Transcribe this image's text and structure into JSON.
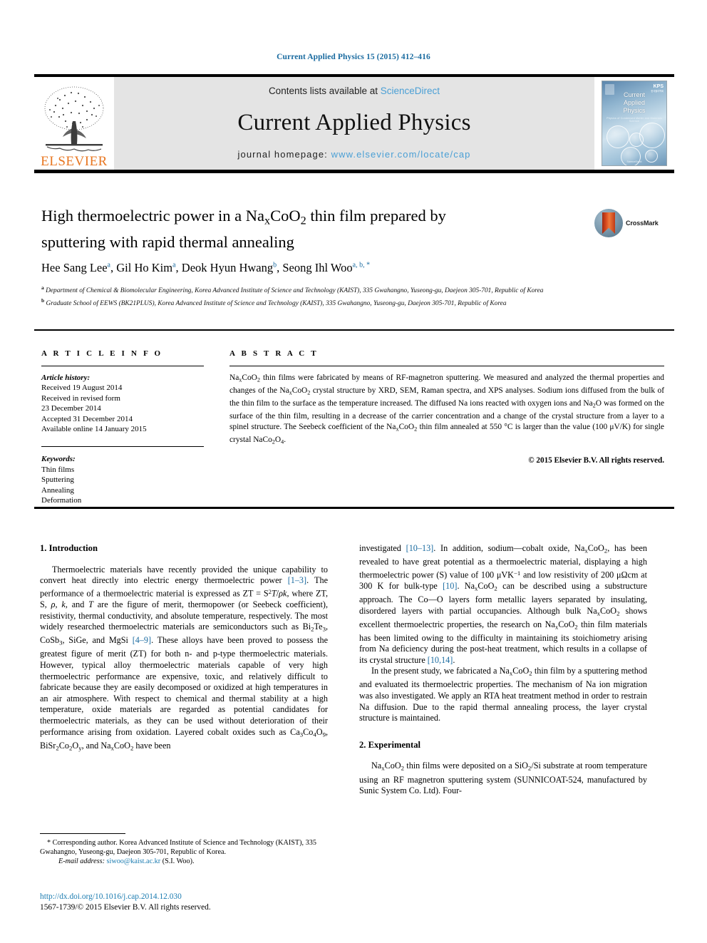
{
  "running_head": "Current Applied Physics 15 (2015) 412–416",
  "masthead": {
    "contents_prefix": "Contents lists available at ",
    "contents_link": "ScienceDirect",
    "journal_title": "Current Applied Physics",
    "homepage_prefix": "journal homepage: ",
    "homepage_url": "www.elsevier.com/locate/cap",
    "publisher_wordmark": "ELSEVIER",
    "cover": {
      "line1": "Current",
      "line2": "Applied",
      "line3": "Physics",
      "subtitle": "Physics of Condensed Matter and Materials Science",
      "badge": "KPS",
      "badge_sub": "한국물리학회",
      "footer": "ScienceDirect"
    }
  },
  "article": {
    "title_line1": "High thermoelectric power in a Na",
    "title_sub1": "x",
    "title_line1b": "CoO",
    "title_sub2": "2",
    "title_line1c": " thin film prepared by",
    "title_line2": "sputtering with rapid thermal annealing",
    "crossmark_label": "CrossMark",
    "authors": [
      {
        "name": "Hee Sang Lee",
        "marks": "a"
      },
      {
        "name": "Gil Ho Kim",
        "marks": "a"
      },
      {
        "name": "Deok Hyun Hwang",
        "marks": "b"
      },
      {
        "name": "Seong Ihl Woo",
        "marks": "a, b, *"
      }
    ],
    "affiliations": [
      {
        "mark": "a",
        "text": "Department of Chemical & Biomolecular Engineering, Korea Advanced Institute of Science and Technology (KAIST), 335 Gwahangno, Yuseong-gu, Daejeon 305-701, Republic of Korea"
      },
      {
        "mark": "b",
        "text": "Graduate School of EEWS (BK21PLUS), Korea Advanced Institute of Science and Technology (KAIST), 335 Gwahangno, Yuseong-gu, Daejeon 305-701, Republic of Korea"
      }
    ]
  },
  "info": {
    "heading": "A R T I C L E   I N F O",
    "history_label": "Article history:",
    "history": [
      "Received 19 August 2014",
      "Received in revised form",
      "23 December 2014",
      "Accepted 31 December 2014",
      "Available online 14 January 2015"
    ],
    "keywords_label": "Keywords:",
    "keywords": [
      "Thin films",
      "Sputtering",
      "Annealing",
      "Deformation"
    ]
  },
  "abstract": {
    "heading": "A B S T R A C T",
    "body": "thin films were fabricated by means of RF-magnetron sputtering. We measured and analyzed the thermal properties and changes of the Na CoO crystal structure by XRD, SEM, Raman spectra, and XPS analyses. Sodium ions diffused from the bulk of the thin film to the surface as the temperature increased. The diffused Na ions reacted with oxygen ions and Na O was formed on the surface of the thin film, resulting in a decrease of the carrier concentration and a change of the crystal structure from a layer to a spinel structure. The Seebeck coefficient of the Na CoO thin film annealed at 550 °C is larger than the value (100 μV/K) for single crystal NaCo O .",
    "copyright": "© 2015 Elsevier B.V. All rights reserved."
  },
  "sections": {
    "intro_heading": "1.  Introduction",
    "experimental_heading": "2.  Experimental",
    "intro_p1_parts": {
      "t1": "Thermoelectric materials have recently provided the unique capability to convert heat directly into electric energy thermoelectric power ",
      "ref1": "[1–3]",
      "t2": ". The performance of a thermoelectric material is expressed as ZT = S",
      "t3": "T/ρk, where ZT, S, ρ, k, and T are the figure of merit, thermopower (or Seebeck coefficient), resistivity, thermal conductivity, and absolute temperature, respectively. The most widely researched thermoelectric materials are semiconductors such as Bi",
      "t4": "Te",
      "t5": ", CoSb",
      "t6": ", SiGe, and MgSi ",
      "ref2": "[4–9]",
      "t7": ". These alloys have been proved to possess the greatest figure of merit (ZT) for both n- and p-type thermoelectric materials. However, typical alloy thermoelectric materials capable of very high thermoelectric performance are expensive, toxic, and relatively difficult to fabricate because they are easily decomposed or oxidized at high temperatures in an air atmosphere. With respect to chemical and thermal stability at a high temperature, oxide materials are regarded as potential candidates for thermoelectric materials, as they can be used without deterioration of their performance arising from oxidation. Layered cobalt oxides such as Ca",
      "t8": "Co",
      "t9": "O",
      "t10": ", BiSr",
      "t11": "Co",
      "t12": "O",
      "t13": ", and Na",
      "t14": "CoO",
      "t15": " have been"
    },
    "right_p1_parts": {
      "t1": "investigated ",
      "ref1": "[10–13]",
      "t2": ". In addition, sodium—cobalt oxide, Na",
      "t3": "CoO",
      "t4": ", has been revealed to have great potential as a thermoelectric material, displaying a high thermoelectric power (S) value of 100 μVK",
      "t5": "−1",
      "t6": " and low resistivity of 200 μΩcm at 300 K for bulk-type ",
      "ref2": "[10]",
      "t7": ". Na",
      "t8": "CoO",
      "t9": " can be described using a substructure approach. The Co—O layers form metallic layers separated by insulating, disordered layers with partial occupancies. Although bulk Na",
      "t10": "CoO",
      "t11": " shows excellent thermoelectric properties, the research on Na",
      "t12": "CoO",
      "t13": " thin film materials has been limited owing to the difficulty in maintaining its stoichiometry arising from Na deficiency during the post-heat treatment, which results in a collapse of its crystal structure ",
      "ref3": "[10,14]",
      "t14": "."
    },
    "right_p2_parts": {
      "t1": "In the present study, we fabricated a Na",
      "t2": "CoO",
      "t3": " thin film by a sputtering method and evaluated its thermoelectric properties. The mechanism of Na ion migration was also investigated. We apply an RTA heat treatment method in order to restrain Na diffusion. Due to the rapid thermal annealing process, the layer crystal structure is maintained."
    },
    "exp_p1_parts": {
      "t1": "Na",
      "t2": "CoO",
      "t3": " thin films were deposited on a SiO",
      "t4": "/Si substrate at room temperature using an RF magnetron sputtering system (SUNNICOAT-524, manufactured by Sunic System Co. Ltd). Four-"
    }
  },
  "footnote": {
    "star": "*",
    "text": " Corresponding author. Korea Advanced Institute of Science and Technology (KAIST), 335 Gwahangno, Yuseong-gu, Daejeon 305-701, Republic of Korea.",
    "email_label": "E-mail address:",
    "email": "siwoo@kaist.ac.kr",
    "email_suffix": " (S.I. Woo)."
  },
  "doi_block": {
    "doi": "http://dx.doi.org/10.1016/j.cap.2014.12.030",
    "issn_line": "1567-1739/© 2015 Elsevier B.V. All rights reserved."
  },
  "colors": {
    "link": "#1a7bb0",
    "ref": "#1a6ba0",
    "sciencedirect": "#4a9fd5",
    "elsevier_orange": "#E87722",
    "band_gray": "#e4e4e4"
  }
}
